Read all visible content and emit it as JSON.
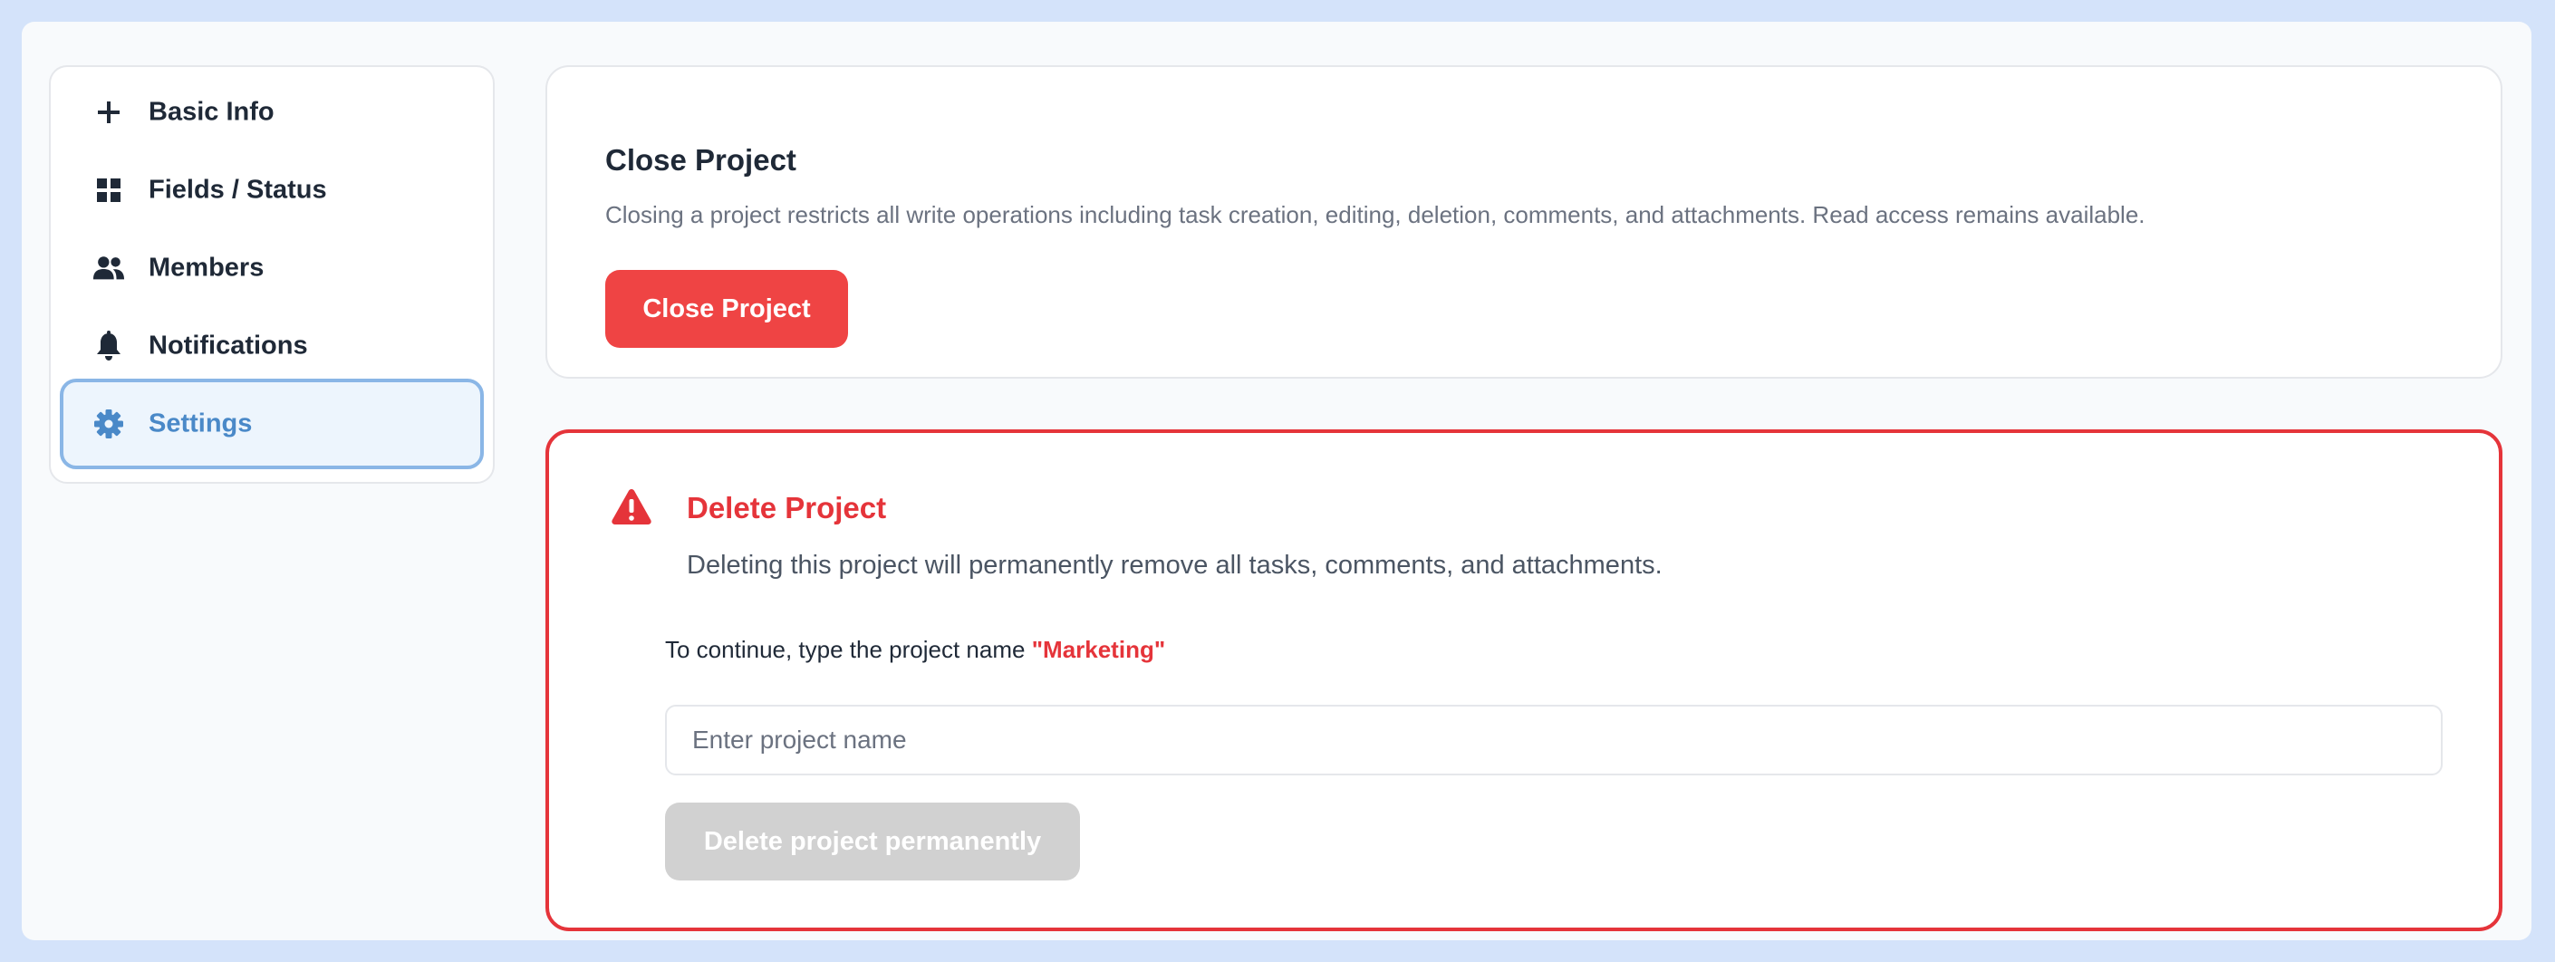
{
  "sidebar": {
    "items": [
      {
        "label": "Basic Info",
        "icon": "plus-icon"
      },
      {
        "label": "Fields / Status",
        "icon": "grid-icon"
      },
      {
        "label": "Members",
        "icon": "members-icon"
      },
      {
        "label": "Notifications",
        "icon": "bell-icon"
      },
      {
        "label": "Settings",
        "icon": "gear-icon",
        "active": true
      }
    ]
  },
  "close_project": {
    "title": "Close Project",
    "description": "Closing a project restricts all write operations including task creation, editing, deletion, comments, and attachments. Read access remains available.",
    "button_label": "Close Project"
  },
  "delete_project": {
    "title": "Delete Project",
    "description": "Deleting this project will permanently remove all tasks, comments, and attachments.",
    "confirm_prefix": "To continue, type the project name ",
    "project_name": "\"Marketing\"",
    "input_value": "",
    "input_placeholder": "Enter project name",
    "button_label": "Delete project permanently",
    "button_enabled": false
  },
  "colors": {
    "accent": "#4a89c8",
    "danger": "#e5343a",
    "danger_button": "#ef4444",
    "disabled_button": "#d1d1d1",
    "page_background": "#d4e3fa"
  }
}
